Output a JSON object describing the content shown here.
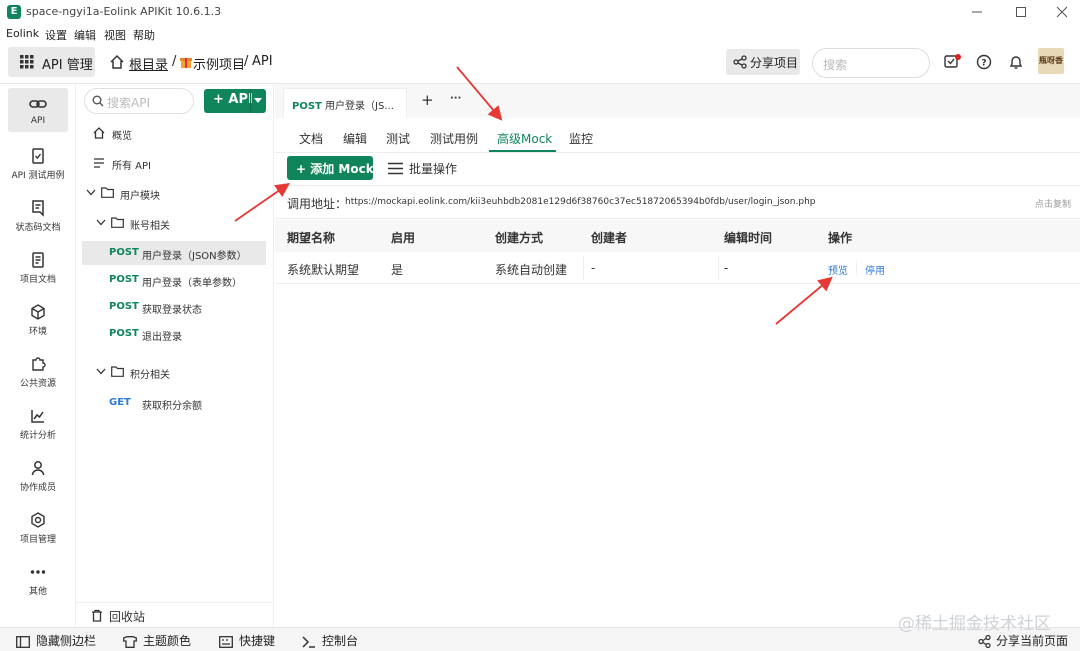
{
  "window": {
    "title": "space-ngyi1a-Eolink APIKit 10.6.1.3",
    "app_icon_letter": "E"
  },
  "menu": [
    "Eolink",
    "设置",
    "编辑",
    "视图",
    "帮助"
  ],
  "toolbar": {
    "module_label": "API 管理",
    "breadcrumb_root": "根目录",
    "breadcrumb_sep1": "/",
    "breadcrumb_project": "示例项目",
    "breadcrumb_sep2": "/",
    "breadcrumb_current": "API",
    "share_label": "分享项目",
    "search_placeholder": "搜索",
    "avatar_text": "瓶呀香"
  },
  "leftnav": [
    {
      "label": "API",
      "icon": "link-icon"
    },
    {
      "label": "API 测试用例",
      "icon": "testcase-icon"
    },
    {
      "label": "状态码文档",
      "icon": "statuscode-icon"
    },
    {
      "label": "项目文档",
      "icon": "document-icon"
    },
    {
      "label": "环境",
      "icon": "cube-icon"
    },
    {
      "label": "公共资源",
      "icon": "puzzle-icon"
    },
    {
      "label": "统计分析",
      "icon": "chart-icon"
    },
    {
      "label": "协作成员",
      "icon": "member-icon"
    },
    {
      "label": "项目管理",
      "icon": "gear-icon"
    },
    {
      "label": "其他",
      "icon": "more-icon"
    }
  ],
  "tree": {
    "search_placeholder": "搜索API",
    "add_label": "+ API",
    "overview": "概览",
    "all_api": "所有 API",
    "group_user": "用户模块",
    "group_account": "账号相关",
    "apis": [
      {
        "method": "POST",
        "name": "用户登录（JSON参数）"
      },
      {
        "method": "POST",
        "name": "用户登录（表单参数）"
      },
      {
        "method": "POST",
        "name": "获取登录状态"
      },
      {
        "method": "POST",
        "name": "退出登录"
      }
    ],
    "group_points": "积分相关",
    "points_api": {
      "method": "GET",
      "name": "获取积分余额"
    },
    "recycle": "回收站"
  },
  "main": {
    "doc_tab": {
      "method": "POST",
      "name": "用户登录（JS..."
    },
    "tab_add": "+",
    "tab_more": "···",
    "subtabs": [
      "文档",
      "编辑",
      "测试",
      "测试用例",
      "高级Mock",
      "监控"
    ],
    "add_mock_label": "+ 添加 Mock",
    "bulk_label": "批量操作",
    "url_label": "调用地址：",
    "url_value": "https://mockapi.eolink.com/kii3euhbdb2081e129d6f38760c37ec51872065394b0fdb/user/login_json.php",
    "copy_label": "点击复制",
    "columns": [
      "期望名称",
      "启用",
      "创建方式",
      "创建者",
      "编辑时间",
      "操作"
    ],
    "rows": [
      {
        "name": "系统默认期望",
        "enabled": "是",
        "method": "系统自动创建",
        "creator": "-",
        "edit_time": "-",
        "action_preview": "预览",
        "action_disable": "停用"
      }
    ]
  },
  "bottombar": {
    "hide_sidebar": "隐藏侧边栏",
    "theme": "主题颜色",
    "shortcuts": "快捷键",
    "console": "控制台",
    "share_page": "分享当前页面"
  },
  "watermark": "@稀土掘金技术社区",
  "colors": {
    "accent": "#10855c",
    "link": "#2f7ad6",
    "annotation_arrow": "#e53935"
  }
}
